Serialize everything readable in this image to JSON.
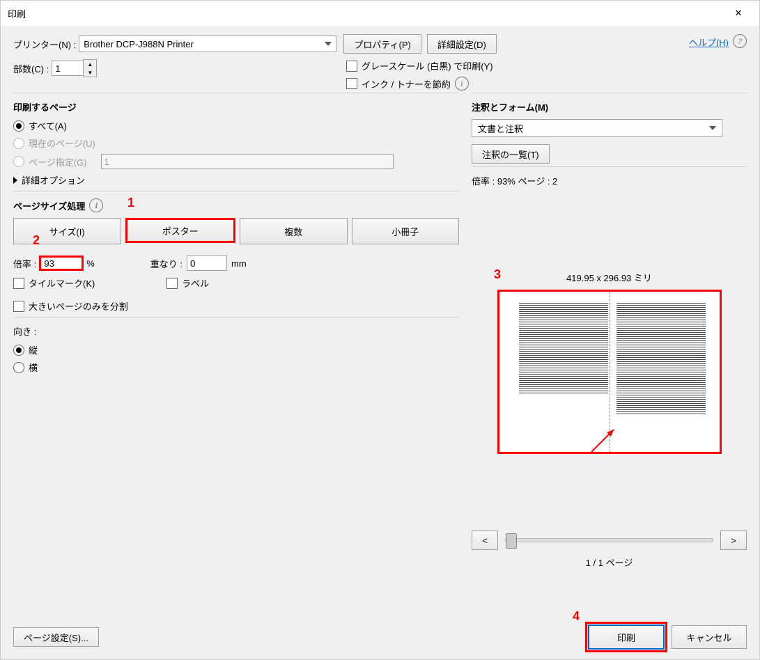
{
  "title": "印刷",
  "printer": {
    "label": "プリンター(N) :",
    "value": "Brother DCP-J988N Printer"
  },
  "buttons": {
    "properties": "プロパティ(P)",
    "advanced": "詳細設定(D)"
  },
  "copies": {
    "label": "部数(C) :",
    "value": "1"
  },
  "options": {
    "grayscale": "グレースケール (白黒) で印刷(Y)",
    "saveink": "インク / トナーを節約"
  },
  "help": "ヘルプ(H)",
  "range": {
    "title": "印刷するページ",
    "all": "すべて(A)",
    "current": "現在のページ(U)",
    "pages": "ページ指定(G)",
    "pages_value": "1",
    "more": "詳細オプション"
  },
  "sizing": {
    "title": "ページサイズ処理",
    "tabs": [
      "サイズ(I)",
      "ポスター",
      "複数",
      "小冊子"
    ],
    "scale_label": "倍率 :",
    "scale_value": "93",
    "scale_unit": "%",
    "overlap_label": "重なり :",
    "overlap_value": "0",
    "overlap_unit": "mm",
    "tilemark": "タイルマーク(K)",
    "labels": "ラベル",
    "bigonly": "大きいページのみを分割"
  },
  "orient": {
    "title": "向き :",
    "portrait": "縦",
    "landscape": "横"
  },
  "comments": {
    "title": "注釈とフォーム(M)",
    "value": "文書と注釈",
    "summary": "注釈の一覧(T)"
  },
  "preview": {
    "status": "倍率 :  93% ページ : 2",
    "dims": "419.95 x 296.93 ミリ",
    "page_of": "1 / 1 ページ",
    "prev": "<",
    "next": ">"
  },
  "footer": {
    "pagesetup": "ページ設定(S)...",
    "print": "印刷",
    "cancel": "キャンセル"
  },
  "anno": {
    "n1": "1",
    "n2": "2",
    "n3": "3",
    "n4": "4"
  }
}
